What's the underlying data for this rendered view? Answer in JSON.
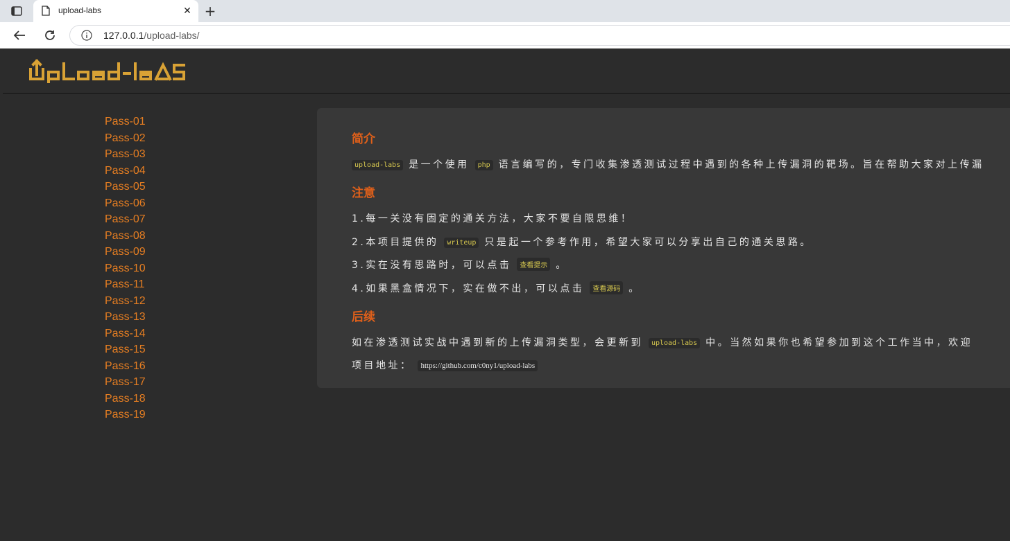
{
  "browser": {
    "tab_title": "upload-labs",
    "url_host": "127.0.0.1",
    "url_path": "/upload-labs/",
    "new_tab_label": "+",
    "close_tab_label": "✕"
  },
  "site": {
    "logo_text": "upload-labs"
  },
  "sidebar": {
    "items": [
      "Pass-01",
      "Pass-02",
      "Pass-03",
      "Pass-04",
      "Pass-05",
      "Pass-06",
      "Pass-07",
      "Pass-08",
      "Pass-09",
      "Pass-10",
      "Pass-11",
      "Pass-12",
      "Pass-13",
      "Pass-14",
      "Pass-15",
      "Pass-16",
      "Pass-17",
      "Pass-18",
      "Pass-19"
    ]
  },
  "intro": {
    "heading": "简介",
    "code1": "upload-labs",
    "text1": "是一个使用",
    "code2": "php",
    "text2": "语言编写的，专门收集渗透测试过程中遇到的各种上传漏洞的靶场。旨在帮助大家对上传漏"
  },
  "notes": {
    "heading": "注意",
    "line1": "1.每一关没有固定的通关方法，大家不要自限思维！",
    "line2_a": "2.本项目提供的",
    "line2_code": "writeup",
    "line2_b": "只是起一个参考作用，希望大家可以分享出自己的通关思路。",
    "line3_a": "3.实在没有思路时，可以点击",
    "line3_code": "查看提示",
    "line3_b": "。",
    "line4_a": "4.如果黑盒情况下，实在做不出，可以点击",
    "line4_code": "查看源码",
    "line4_b": "。"
  },
  "followup": {
    "heading": "后续",
    "line1_a": "如在渗透测试实战中遇到新的上传漏洞类型，会更新到",
    "line1_code": "upload-labs",
    "line1_b": "中。当然如果你也希望参加到这个工作当中，欢迎",
    "line2_label": "项目地址：",
    "line2_link": "https://github.com/c0ny1/upload-labs"
  },
  "colors": {
    "accent": "#e67e22",
    "heading": "#e0601a",
    "logo": "#d9a235",
    "background": "#2c2c2c",
    "panel": "#383838"
  }
}
